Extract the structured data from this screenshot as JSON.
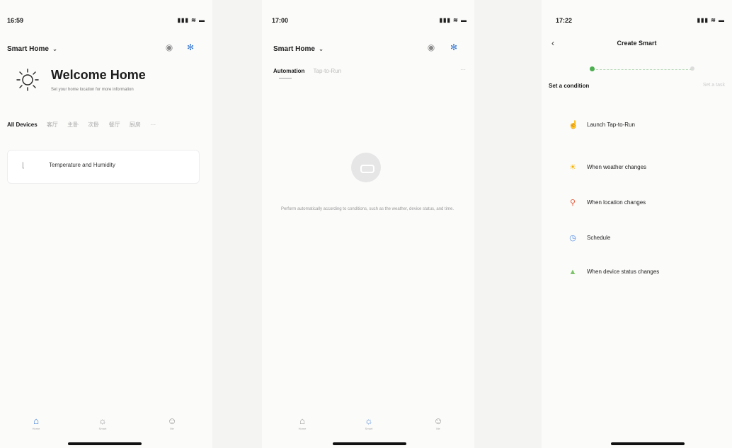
{
  "screens": [
    {
      "status": {
        "time": "16:59",
        "indicators": "▮▮▮ ≋ ▬"
      },
      "header": {
        "home_name": "Smart Home",
        "chevron": "⌄"
      },
      "welcome": {
        "title": "Welcome Home",
        "subtitle": "Set your home location for more information"
      },
      "tabs": [
        {
          "label": "All Devices",
          "active": true
        },
        {
          "label": "客厅",
          "active": false
        },
        {
          "label": "主卧",
          "active": false
        },
        {
          "label": "次卧",
          "active": false
        },
        {
          "label": "餐厅",
          "active": false
        },
        {
          "label": "厨房",
          "active": false
        },
        {
          "label": "···",
          "active": false
        }
      ],
      "device": {
        "name": "Temperature and Humidity",
        "icon": "thermometer-icon"
      },
      "tabbar": [
        {
          "label": "Home",
          "icon": "home-icon"
        },
        {
          "label": "Smart",
          "icon": "sun-icon"
        },
        {
          "label": "Me",
          "icon": "profile-icon"
        }
      ]
    },
    {
      "status": {
        "time": "17:00",
        "indicators": "▮▮▮ ≋ ▬"
      },
      "header": {
        "home_name": "Smart Home",
        "chevron": "⌄"
      },
      "tabs": [
        {
          "label": "Automation",
          "active": true
        },
        {
          "label": "Tap-to-Run",
          "active": false
        }
      ],
      "more": "···",
      "empty_text": "Perform automatically according to conditions, such as the weather, device status, and time.",
      "tabbar": [
        {
          "label": "Home",
          "icon": "home-icon"
        },
        {
          "label": "Smart",
          "icon": "sun-icon"
        },
        {
          "label": "Me",
          "icon": "profile-icon"
        }
      ]
    },
    {
      "status": {
        "time": "17:22",
        "indicators": "▮▮▮ ≋ ▬"
      },
      "back": "‹",
      "title": "Create Smart",
      "condition_label": "Set a condition",
      "condition_right": "Set a task",
      "conditions": [
        {
          "label": "Launch Tap-to-Run",
          "icon": "hand-icon"
        },
        {
          "label": "When weather changes",
          "icon": "sun-icon"
        },
        {
          "label": "When location changes",
          "icon": "location-pin-icon"
        },
        {
          "label": "Schedule",
          "icon": "clock-icon"
        },
        {
          "label": "When device status changes",
          "icon": "device-icon"
        }
      ]
    }
  ],
  "colors": {
    "accent": "#3a7bd5",
    "progress": "#4caf50"
  }
}
